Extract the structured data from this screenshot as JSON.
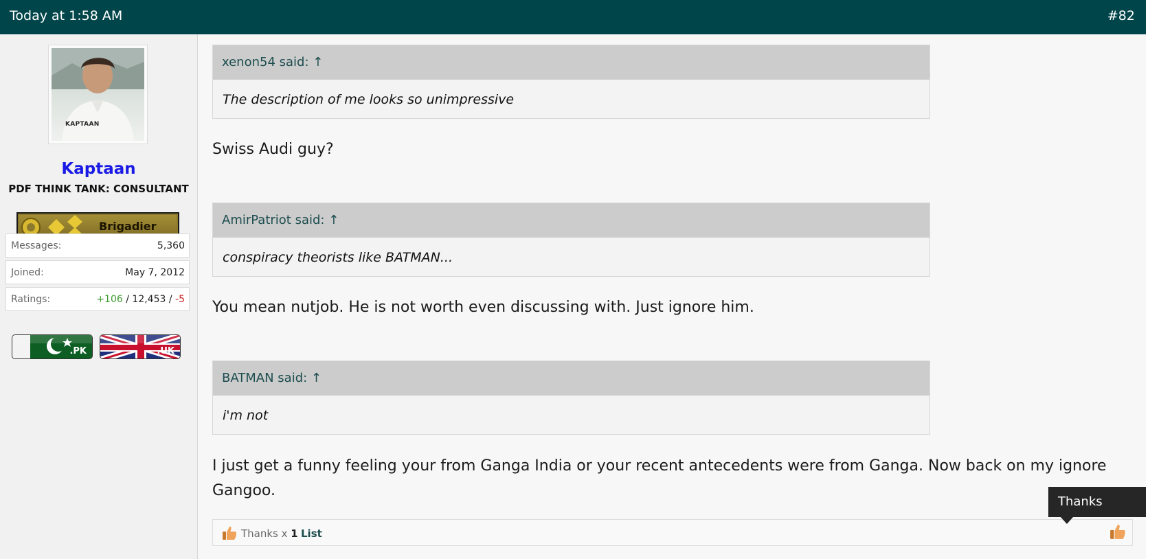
{
  "post": {
    "date": "Today at 1:58 AM",
    "number": "#82"
  },
  "author": {
    "avatar_caption": "KAPTAAN",
    "username": "Kaptaan",
    "title": "PDF THINK TANK: CONSULTANT",
    "rank_badge": "Brigadier",
    "stats": {
      "messages_label": "Messages:",
      "messages_value": "5,360",
      "joined_label": "Joined:",
      "joined_value": "May 7, 2012",
      "ratings_label": "Ratings:",
      "ratings_positive": "+106",
      "ratings_sep1": " / ",
      "ratings_neutral": "12,453",
      "ratings_sep2": " / ",
      "ratings_negative": "-5"
    },
    "flags": [
      {
        "tld": ".PK",
        "icon": "pakistan-flag-icon"
      },
      {
        "tld": ".UK",
        "icon": "uk-flag-icon"
      }
    ]
  },
  "content": {
    "blocks": [
      {
        "quote_author": "xenon54 said: ↑",
        "quote_text": "The description of me looks so unimpressive",
        "reply": "Swiss Audi guy?"
      },
      {
        "quote_author": "AmirPatriot said: ↑",
        "quote_text": "conspiracy theorists like BATMAN...",
        "reply": "You mean nutjob. He is not worth even discussing with. Just ignore him."
      },
      {
        "quote_author": "BATMAN said: ↑",
        "quote_text": "i'm not",
        "reply": "I just get a funny feeling your from Ganga India or your recent antecedents were from Ganga. Now back on my ignore Gangoo."
      }
    ]
  },
  "footer": {
    "thanks_label": "Thanks x",
    "thanks_count": "1",
    "list_label": "List",
    "tooltip": "Thanks"
  },
  "colors": {
    "header_bg": "#004549",
    "username": "#1a1ae6",
    "link": "#1d4d4f",
    "positive": "#3d9b2f",
    "negative": "#cc2222"
  }
}
